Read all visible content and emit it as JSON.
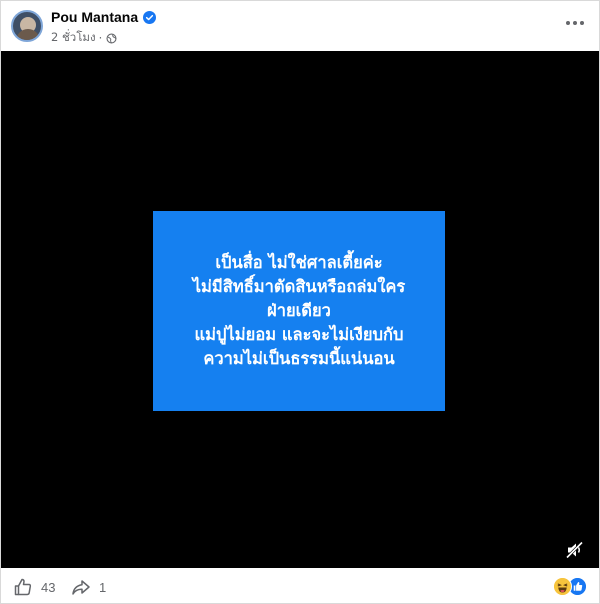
{
  "post": {
    "author": "Pou Mantana",
    "timestamp": "2 ชั่วโมง",
    "separator": "·",
    "audience_icon": "globe-icon",
    "verified_icon": "verified-badge-icon",
    "more_icon": "more-options-icon"
  },
  "video": {
    "card_lines": [
      "เป็นสื่อ ไม่ใช่ศาลเตี้ยค่ะ",
      "ไม่มีสิทธิ์มาตัดสินหรือถล่มใคร",
      "ฝ่ายเดียว",
      "แม่ปูไม่ยอม และจะไม่เงียบกับ",
      "ความไม่เป็นธรรมนี้แน่นอน"
    ],
    "mute_icon": "muted-speaker-icon"
  },
  "footer": {
    "likes": "43",
    "shares": "1",
    "like_icon": "thumbs-up-icon",
    "share_icon": "share-arrow-icon",
    "reactions": [
      "haha",
      "like"
    ]
  },
  "colors": {
    "brand_blue": "#1877f2",
    "card_blue": "#1580f0",
    "video_bg": "#000000",
    "text_secondary": "#65676b"
  }
}
